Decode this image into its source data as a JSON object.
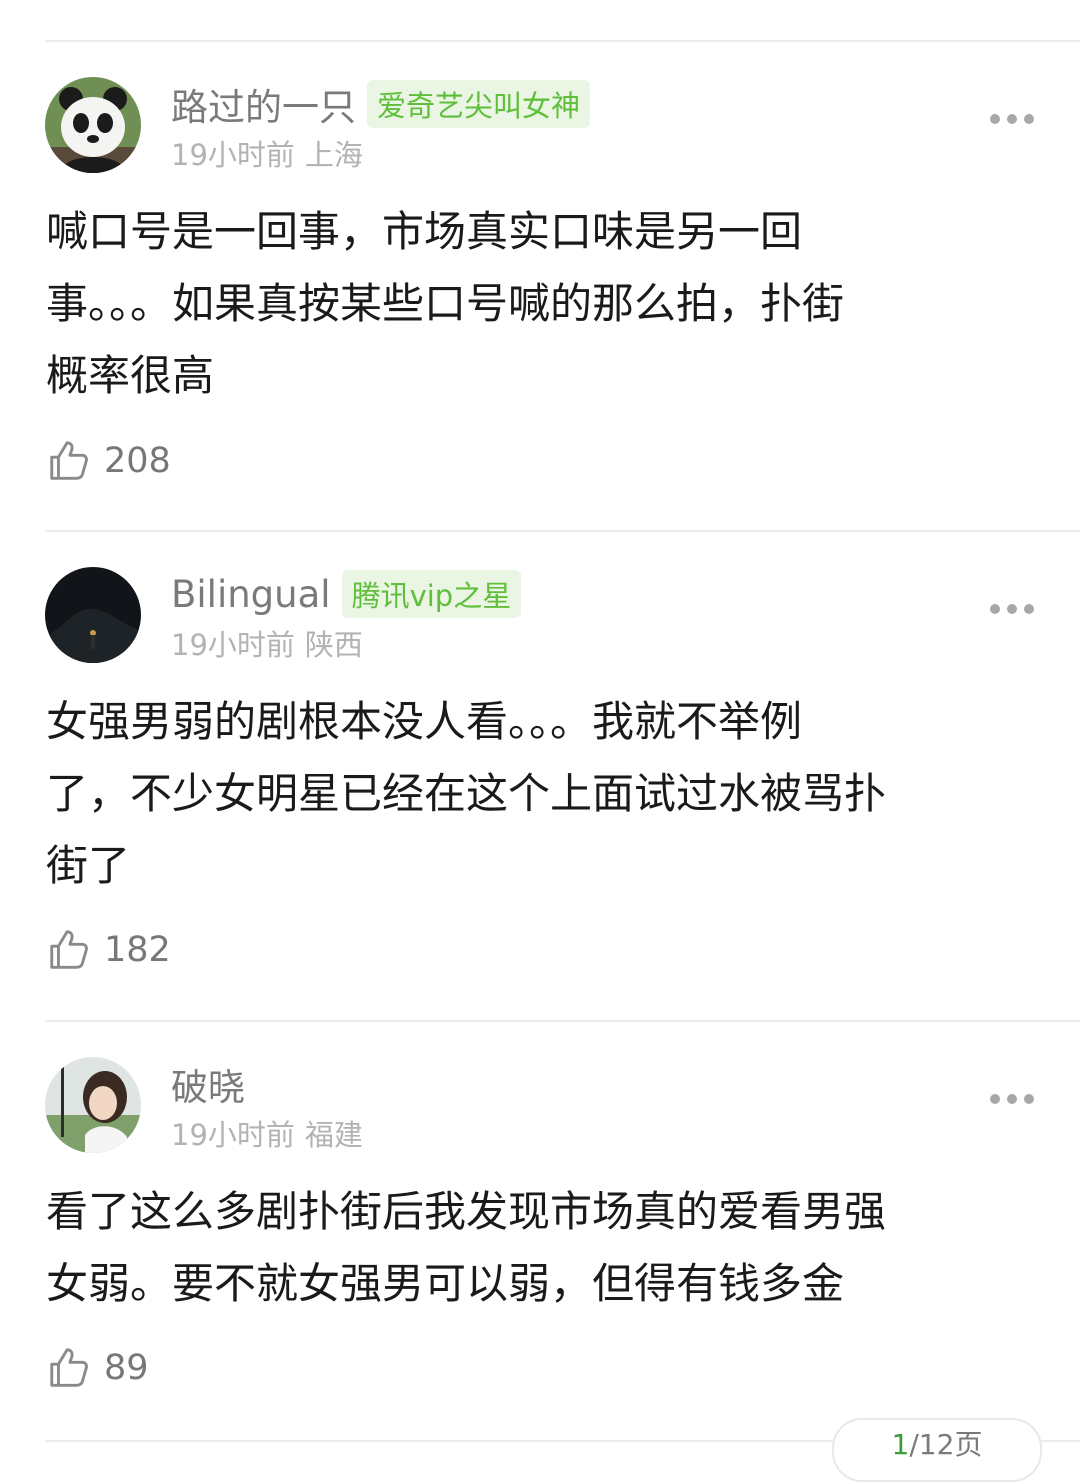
{
  "comments": [
    {
      "username": "路过的一只",
      "badge": "爱奇艺尖叫女神",
      "time": "19小时前",
      "location": "上海",
      "text": "喊口号是一回事，市场真实口味是另一回\n事。。。如果真按某些口号喊的那么拍，扑街\n概率很高",
      "likes": "208",
      "avatar_icon": "panda-avatar"
    },
    {
      "username": "Bilingual",
      "badge": "腾讯vip之星",
      "time": "19小时前",
      "location": "陕西",
      "text": "女强男弱的剧根本没人看。。。我就不举例\n了，不少女明星已经在这个上面试过水被骂扑\n街了",
      "likes": "182",
      "avatar_icon": "night-scene-avatar"
    },
    {
      "username": "破晓",
      "badge": "",
      "time": "19小时前",
      "location": "福建",
      "text": "看了这么多剧扑街后我发现市场真的爱看男强\n女弱。要不就女强男可以弱，但得有钱多金",
      "likes": "89",
      "avatar_icon": "girl-portrait-avatar"
    }
  ],
  "pager": {
    "current": "1",
    "total_text": "/12页"
  },
  "colors": {
    "badge_text": "#5fbf3b",
    "badge_bg": "#eaf5e3",
    "pager_current": "#3a9d3a"
  }
}
